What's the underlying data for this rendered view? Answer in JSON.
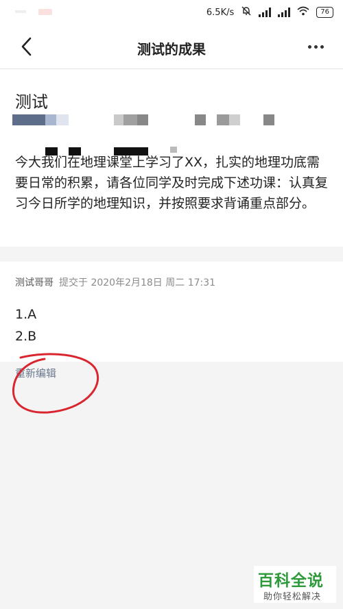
{
  "status_bar": {
    "net_speed": "6.5K/s",
    "battery": "76"
  },
  "header": {
    "title": "测试的成果"
  },
  "task": {
    "title": "测试",
    "description": "今大我们在地理课堂上学习了XX，扎实的地理功底需要日常的积累，请各位同学及时完成下述功课：认真复习今日所学的地理知识，并按照要求背诵重点部分。"
  },
  "submission": {
    "author": "测试哥哥",
    "meta": "提交于 2020年2月18日 周二 17:31",
    "answers": [
      "1.A",
      "2.B"
    ],
    "edit_label": "重新编辑"
  },
  "watermark": {
    "title": "百科全说",
    "subtitle": "助你轻松解决"
  },
  "colors": {
    "accent_red": "#d9262e",
    "link": "#6b7a90",
    "watermark_green": "#2e9a3a"
  }
}
